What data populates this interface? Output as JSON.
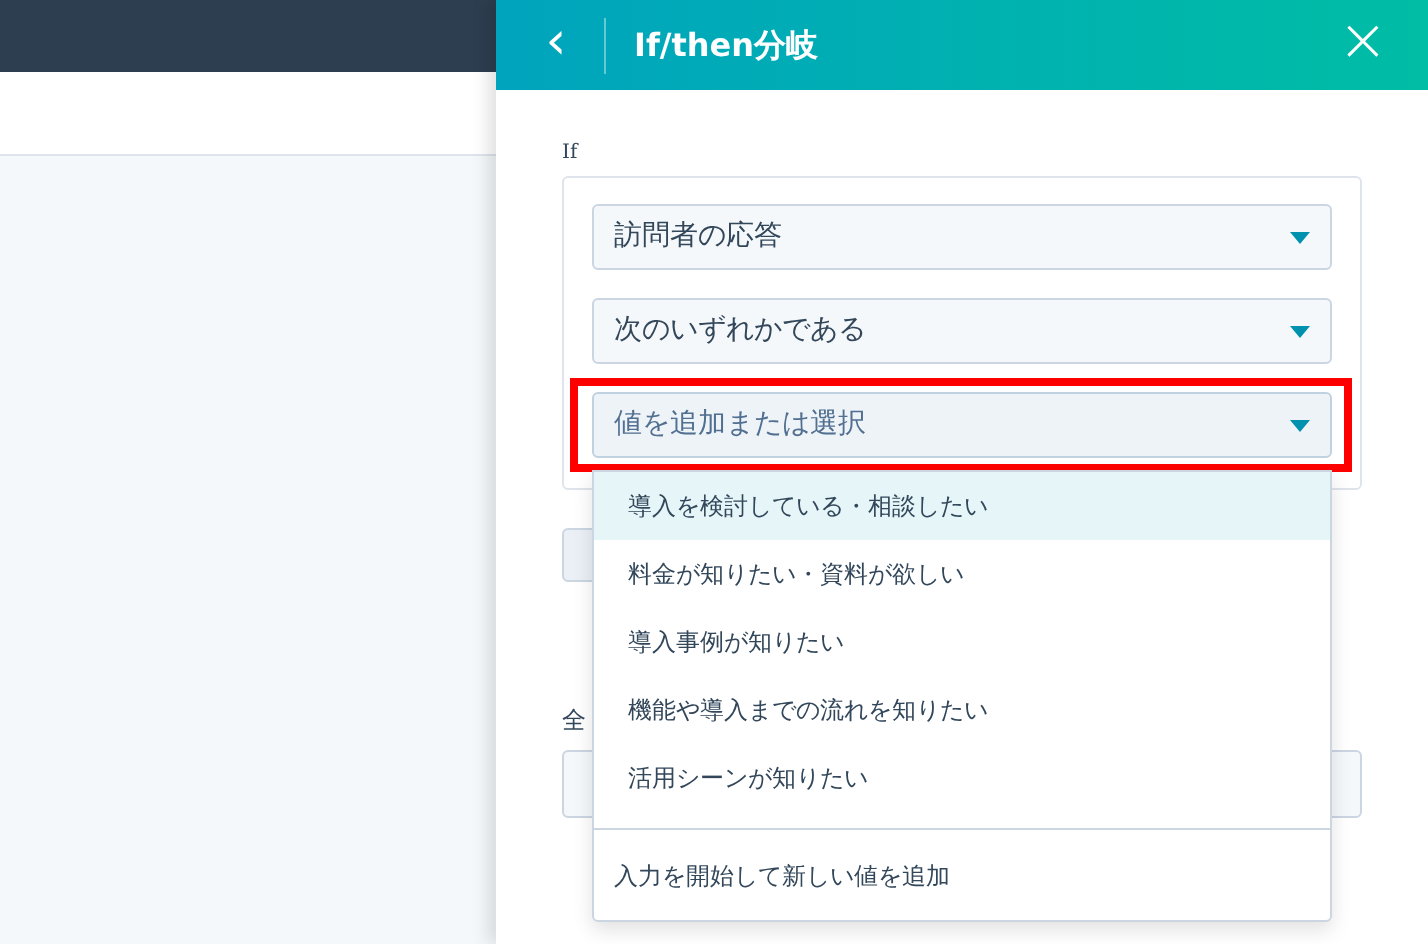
{
  "panel": {
    "title": "If/then分岐",
    "back_label": "‹",
    "close_label": "×"
  },
  "condition": {
    "label": "If",
    "selects": [
      {
        "value": "訪問者の応答"
      },
      {
        "value": "次のいずれかである"
      },
      {
        "placeholder": "値を追加または選択",
        "open": true,
        "highlighted": true
      }
    ]
  },
  "menu": {
    "options": [
      {
        "label": "導入を検討している・相談したい",
        "selected": true
      },
      {
        "label": "料金が知りたい・資料が欲しい",
        "selected": false
      },
      {
        "label": "導入事例が知りたい",
        "selected": false
      },
      {
        "label": "機能や導入までの流れを知りたい",
        "selected": false
      },
      {
        "label": "活用シーンが知りたい",
        "selected": false
      }
    ],
    "footer": "入力を開始して新しい値を追加"
  },
  "below": {
    "label": "全"
  }
}
